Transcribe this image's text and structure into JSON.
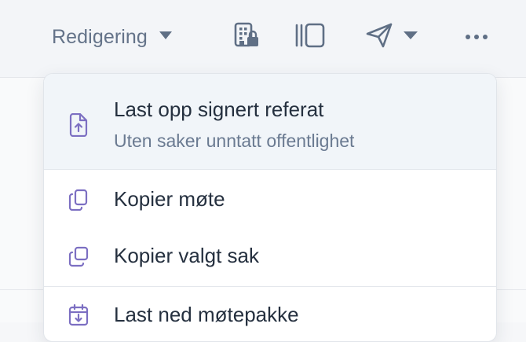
{
  "toolbar": {
    "mode_label": "Redigering",
    "icons": {
      "mode_caret": "caret-down-icon",
      "building_lock": "building-lock-icon",
      "panel": "panel-toggle-icon",
      "send": "send-icon",
      "send_caret": "caret-down-icon",
      "more": "more-horizontal-icon"
    }
  },
  "menu": {
    "items": [
      {
        "title": "Last opp signert referat",
        "subtitle": "Uten saker unntatt offentlighet",
        "icon": "file-upload-icon"
      },
      {
        "title": "Kopier møte",
        "icon": "copy-icon"
      },
      {
        "title": "Kopier valgt sak",
        "icon": "copy-outline-icon"
      },
      {
        "title": "Last ned møtepakke",
        "icon": "calendar-download-icon"
      }
    ]
  },
  "colors": {
    "toolbar_bg": "#f3f5f8",
    "toolbar_text": "#647389",
    "icon_color": "#5f6f85",
    "menu_icon": "#7c6fc2",
    "highlight_bg": "#f1f5f9",
    "title_text": "#25303f",
    "subtitle_text": "#6a7a91"
  }
}
